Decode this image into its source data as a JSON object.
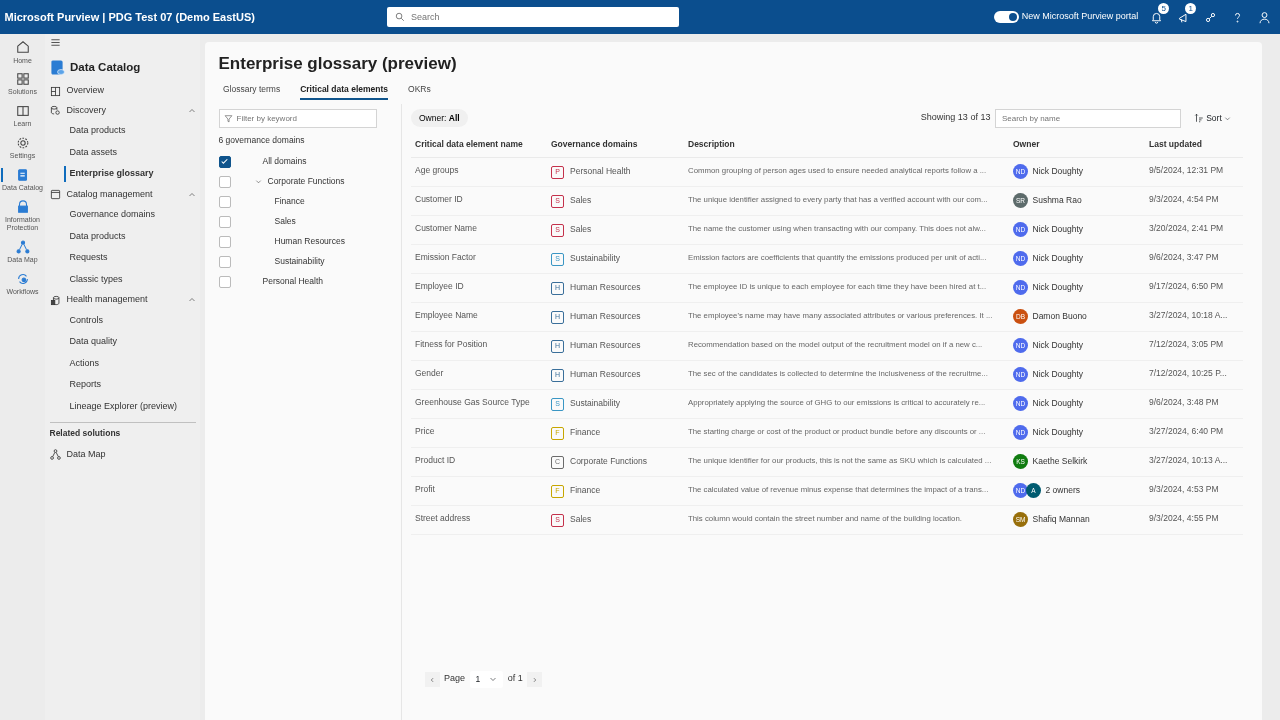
{
  "topbar": {
    "title": "Microsoft Purview | PDG Test 07 (Demo EastUS)",
    "search_placeholder": "Search",
    "toggle": {
      "label": "New Microsoft Purview portal",
      "on": true
    },
    "notification_badge": "5",
    "feedback_badge": "1"
  },
  "rail": [
    {
      "label": "Home",
      "selected": false
    },
    {
      "label": "Solutions",
      "selected": false
    },
    {
      "label": "Learn",
      "selected": false
    },
    {
      "label": "Settings",
      "selected": false
    },
    {
      "label": "Data Catalog",
      "selected": true
    },
    {
      "label": "Information Protection",
      "selected": false
    },
    {
      "label": "Data Map",
      "selected": false
    },
    {
      "label": "Workflows",
      "selected": false
    }
  ],
  "sidebar": {
    "title": "Data Catalog",
    "items": [
      {
        "label": "Overview",
        "kind": "link",
        "selected": false
      },
      {
        "label": "Discovery",
        "kind": "group",
        "expanded": true,
        "children": [
          {
            "label": "Data products",
            "selected": false
          },
          {
            "label": "Data assets",
            "selected": false
          },
          {
            "label": "Enterprise glossary",
            "selected": true
          }
        ]
      },
      {
        "label": "Catalog management",
        "kind": "group",
        "expanded": true,
        "children": [
          {
            "label": "Governance domains",
            "selected": false
          },
          {
            "label": "Data products",
            "selected": false
          },
          {
            "label": "Requests",
            "selected": false
          },
          {
            "label": "Classic types",
            "selected": false
          }
        ]
      },
      {
        "label": "Health management",
        "kind": "group",
        "expanded": true,
        "children": [
          {
            "label": "Controls",
            "selected": false
          },
          {
            "label": "Data quality",
            "selected": false
          },
          {
            "label": "Actions",
            "selected": false
          },
          {
            "label": "Reports",
            "selected": false
          },
          {
            "label": "Lineage Explorer (preview)",
            "selected": false
          }
        ]
      }
    ],
    "related_heading": "Related solutions",
    "related": [
      {
        "label": "Data Map"
      }
    ]
  },
  "page_title": "Enterprise glossary (preview)",
  "tabs": [
    {
      "label": "Glossary terms",
      "selected": false
    },
    {
      "label": "Critical data elements",
      "selected": true
    },
    {
      "label": "OKRs",
      "selected": false
    }
  ],
  "filter": {
    "placeholder": "Filter by keyword",
    "count": "6 governance domains",
    "domains": [
      {
        "label": "All domains",
        "checked": true
      },
      {
        "label": "Corporate Functions",
        "checked": false,
        "expanded": true,
        "children": [
          {
            "label": "Finance",
            "checked": false
          },
          {
            "label": "Sales",
            "checked": false
          },
          {
            "label": "Human Resources",
            "checked": false
          },
          {
            "label": "Sustainability",
            "checked": false
          }
        ]
      },
      {
        "label": "Personal Health",
        "checked": false
      }
    ]
  },
  "toolbar": {
    "owner_filter": "Owner: **All**",
    "showing": "Showing 13 of 13",
    "search_placeholder": "Search by name",
    "sort": "Sort"
  },
  "table": {
    "columns": [
      "Critical data element name",
      "Governance domains",
      "Description",
      "Owner",
      "Last updated"
    ],
    "rows": [
      {
        "name": "Age groups",
        "domain": {
          "letter": "P",
          "label": "Personal Health",
          "color": "#c4314b"
        },
        "description": "Common grouping of person ages used to ensure needed analytical reports follow a ...",
        "owners": [
          {
            "initials": "ND",
            "color": "#4f6bed"
          }
        ],
        "owner_label": "Nick Doughty",
        "updated": "9/5/2024, 12:31 PM"
      },
      {
        "name": "Customer ID",
        "domain": {
          "letter": "S",
          "label": "Sales",
          "color": "#c4314b"
        },
        "description": "The unique identifier assigned to every party that has a verified account with our com...",
        "owners": [
          {
            "initials": "SR",
            "color": "#5d6b6b"
          }
        ],
        "owner_label": "Sushma Rao",
        "updated": "9/3/2024, 4:54 PM"
      },
      {
        "name": "Customer Name",
        "domain": {
          "letter": "S",
          "label": "Sales",
          "color": "#c4314b"
        },
        "description": "The name the customer using when transacting with our company. This does not alw...",
        "owners": [
          {
            "initials": "ND",
            "color": "#4f6bed"
          }
        ],
        "owner_label": "Nick Doughty",
        "updated": "3/20/2024, 2:41 PM"
      },
      {
        "name": "Emission Factor",
        "domain": {
          "letter": "S",
          "label": "Sustainability",
          "color": "#3a96c4"
        },
        "description": "Emission factors are coefficients that quantify the emissions produced per unit of acti...",
        "owners": [
          {
            "initials": "ND",
            "color": "#4f6bed"
          }
        ],
        "owner_label": "Nick Doughty",
        "updated": "9/6/2024, 3:47 PM"
      },
      {
        "name": "Employee ID",
        "domain": {
          "letter": "H",
          "label": "Human Resources",
          "color": "#3a6f9a"
        },
        "description": "The employee ID is unique to each employee for each time they have been hired at t...",
        "owners": [
          {
            "initials": "ND",
            "color": "#4f6bed"
          }
        ],
        "owner_label": "Nick Doughty",
        "updated": "9/17/2024, 6:50 PM"
      },
      {
        "name": "Employee Name",
        "domain": {
          "letter": "H",
          "label": "Human Resources",
          "color": "#3a6f9a"
        },
        "description": "The employee's name may have many associated attributes or various preferences. It ...",
        "owners": [
          {
            "initials": "DB",
            "color": "#ca5010"
          }
        ],
        "owner_label": "Damon Buono",
        "updated": "3/27/2024, 10:18 A..."
      },
      {
        "name": "Fitness for Position",
        "domain": {
          "letter": "H",
          "label": "Human Resources",
          "color": "#3a6f9a"
        },
        "description": "Recommendation based on the model output of the recruitment model on if a new c...",
        "owners": [
          {
            "initials": "ND",
            "color": "#4f6bed"
          }
        ],
        "owner_label": "Nick Doughty",
        "updated": "7/12/2024, 3:05 PM"
      },
      {
        "name": "Gender",
        "domain": {
          "letter": "H",
          "label": "Human Resources",
          "color": "#3a6f9a"
        },
        "description": "The sec of the candidates is collected to determine the inclusiveness of the recruitme...",
        "owners": [
          {
            "initials": "ND",
            "color": "#4f6bed"
          }
        ],
        "owner_label": "Nick Doughty",
        "updated": "7/12/2024, 10:25 P..."
      },
      {
        "name": "Greenhouse Gas Source Type",
        "domain": {
          "letter": "S",
          "label": "Sustainability",
          "color": "#3a96c4"
        },
        "description": "Appropriately applying the source of GHG to our emissions is critical to accurately re...",
        "owners": [
          {
            "initials": "ND",
            "color": "#4f6bed"
          }
        ],
        "owner_label": "Nick Doughty",
        "updated": "9/6/2024, 3:48 PM"
      },
      {
        "name": "Price",
        "domain": {
          "letter": "F",
          "label": "Finance",
          "color": "#c7a600"
        },
        "description": "The starting charge or cost of the product or product bundle before any discounts or ...",
        "owners": [
          {
            "initials": "ND",
            "color": "#4f6bed"
          }
        ],
        "owner_label": "Nick Doughty",
        "updated": "3/27/2024, 6:40 PM"
      },
      {
        "name": "Product ID",
        "domain": {
          "letter": "C",
          "label": "Corporate Functions",
          "color": "#6b6b6b"
        },
        "description": "The unique identifier for our products, this is not the same as SKU which is calculated ...",
        "owners": [
          {
            "initials": "KS",
            "color": "#107c10"
          }
        ],
        "owner_label": "Kaethe Selkirk",
        "updated": "3/27/2024, 10:13 A..."
      },
      {
        "name": "Profit",
        "domain": {
          "letter": "F",
          "label": "Finance",
          "color": "#c7a600"
        },
        "description": "The calculated value of revenue minus expense that determines the impact of a trans...",
        "owners": [
          {
            "initials": "ND",
            "color": "#4f6bed"
          },
          {
            "initials": "A",
            "color": "#005b70"
          }
        ],
        "owner_label": "2 owners",
        "updated": "9/3/2024, 4:53 PM"
      },
      {
        "name": "Street address",
        "domain": {
          "letter": "S",
          "label": "Sales",
          "color": "#c4314b"
        },
        "description": "This column would contain the street number and name of the building location.",
        "owners": [
          {
            "initials": "SM",
            "color": "#986f0b"
          }
        ],
        "owner_label": "Shafiq Mannan",
        "updated": "9/3/2024, 4:55 PM"
      }
    ]
  },
  "pagination": {
    "label": "Page",
    "page": "1",
    "of": "of 1"
  }
}
